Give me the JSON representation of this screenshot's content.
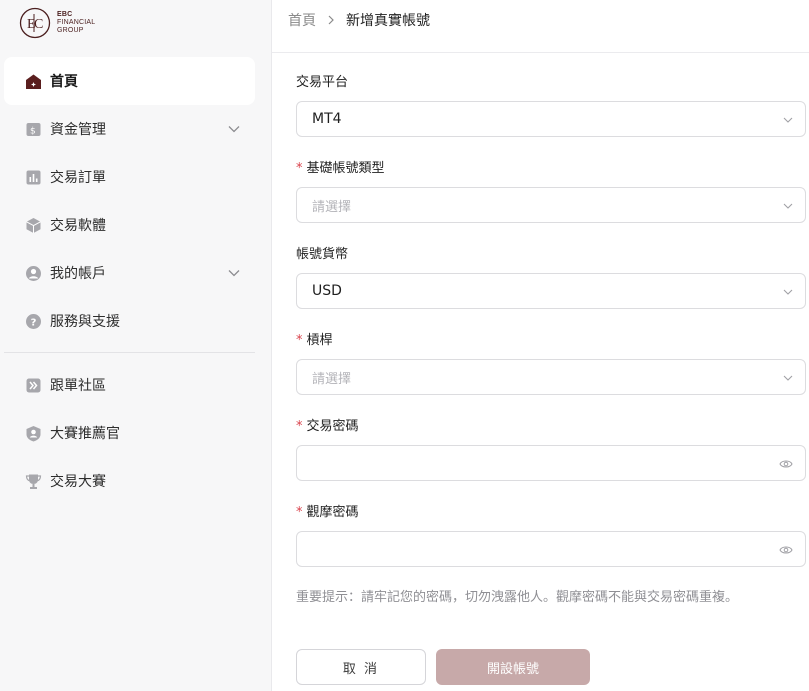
{
  "brand": {
    "line1": "EBC",
    "line2": "FINANCIAL",
    "line3": "GROUP"
  },
  "sidebar": {
    "items": [
      {
        "label": "首頁",
        "icon": "home-icon",
        "active": true
      },
      {
        "label": "資金管理",
        "icon": "wallet-icon",
        "expandable": true
      },
      {
        "label": "交易訂單",
        "icon": "bar-chart-icon"
      },
      {
        "label": "交易軟體",
        "icon": "cube-icon"
      },
      {
        "label": "我的帳戶",
        "icon": "user-icon",
        "expandable": true
      },
      {
        "label": "服務與支援",
        "icon": "help-icon"
      }
    ],
    "items2": [
      {
        "label": "跟單社區",
        "icon": "forward-icon"
      },
      {
        "label": "大賽推薦官",
        "icon": "badge-user-icon"
      },
      {
        "label": "交易大賽",
        "icon": "trophy-icon"
      }
    ]
  },
  "breadcrumb": {
    "home": "首頁",
    "current": "新增真實帳號"
  },
  "form": {
    "platform": {
      "label": "交易平台",
      "value": "MT4"
    },
    "account_type": {
      "label": "基礎帳號類型",
      "placeholder": "請選擇",
      "required": true
    },
    "currency": {
      "label": "帳號貨幣",
      "value": "USD"
    },
    "leverage": {
      "label": "槓桿",
      "placeholder": "請選擇",
      "required": true
    },
    "trade_password": {
      "label": "交易密碼",
      "required": true
    },
    "view_password": {
      "label": "觀摩密碼",
      "required": true
    },
    "hint": "重要提示：請牢記您的密碼，切勿洩露他人。觀摩密碼不能與交易密碼重複。"
  },
  "buttons": {
    "cancel": "取 消",
    "submit": "開設帳號"
  },
  "colors": {
    "brand": "#4b1f1f",
    "required": "#d9414b",
    "submit_disabled": "#c7a9a9"
  }
}
